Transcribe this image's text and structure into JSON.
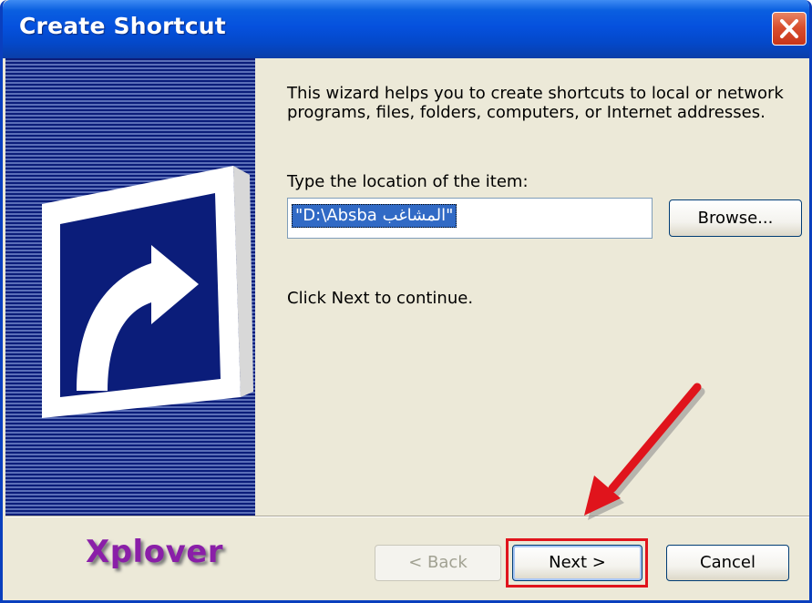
{
  "window": {
    "title": "Create Shortcut",
    "close_symbol": "✕",
    "colors": {
      "titlebar": "#0551de",
      "banner_dark": "#0b1d7a",
      "annotation": "#e0141c",
      "logo": "#8a1fa8"
    }
  },
  "banner": {
    "icon": "shortcut-arrow-icon"
  },
  "wizard": {
    "intro": "This wizard helps you to create shortcuts to local or network programs, files, folders, computers, or Internet addresses.",
    "location_label": "Type the location of the item:",
    "location_value": "\"D:\\Absba المشاغب\"",
    "browse_label": "Browse...",
    "continue_hint": "Click Next to continue."
  },
  "footer": {
    "logo": "Xplover",
    "back_label": "< Back",
    "next_label": "Next >",
    "cancel_label": "Cancel"
  },
  "annotation": {
    "icon": "red-arrow-icon",
    "target": "next-button"
  }
}
